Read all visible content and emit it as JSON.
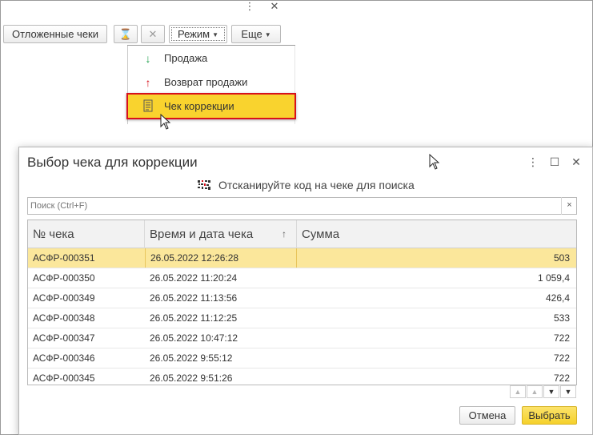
{
  "window": {
    "more_icon": "⋮",
    "close_icon": "✕"
  },
  "toolbar": {
    "deferred_receipts_label": "Отложенные чеки",
    "hourglass_icon": "⌛",
    "cancel_icon": "✕",
    "mode_label": "Режим",
    "more_label": "Еще"
  },
  "mode_menu": {
    "items": [
      {
        "label": "Продажа",
        "icon": "↓",
        "color": "#1a9e4a"
      },
      {
        "label": "Возврат продажи",
        "icon": "↑",
        "color": "#d8111c"
      },
      {
        "label": "Чек коррекции",
        "icon": "receipt-icon",
        "selected": true
      }
    ]
  },
  "dialog": {
    "title": "Выбор чека для коррекции",
    "controls": {
      "more": "⋮",
      "maximize": "☐",
      "close": "✕"
    },
    "scan_hint": "Отсканируйте код на чеке для поиска",
    "search_placeholder": "Поиск (Ctrl+F)",
    "search_clear": "×",
    "table": {
      "columns": [
        "№ чека",
        "Время и дата чека",
        "Сумма"
      ],
      "sort_indicator": "↑",
      "rows": [
        {
          "number": "АСФР-000351",
          "datetime": "26.05.2022 12:26:28",
          "sum": "503",
          "selected": true
        },
        {
          "number": "АСФР-000350",
          "datetime": "26.05.2022 11:20:24",
          "sum": "1 059,4"
        },
        {
          "number": "АСФР-000349",
          "datetime": "26.05.2022 11:13:56",
          "sum": "426,4"
        },
        {
          "number": "АСФР-000348",
          "datetime": "26.05.2022 11:12:25",
          "sum": "533"
        },
        {
          "number": "АСФР-000347",
          "datetime": "26.05.2022 10:47:12",
          "sum": "722"
        },
        {
          "number": "АСФР-000346",
          "datetime": "26.05.2022 9:55:12",
          "sum": "722"
        },
        {
          "number": "АСФР-000345",
          "datetime": "26.05.2022 9:51:26",
          "sum": "722"
        }
      ]
    },
    "nav": {
      "first": "▲",
      "prev": "▲",
      "next": "▼",
      "last": "▼"
    },
    "cancel_label": "Отмена",
    "select_label": "Выбрать"
  },
  "colors": {
    "accent_yellow": "#f9d32e",
    "highlight_red": "#d8111c",
    "row_selected": "#fbe79b"
  }
}
